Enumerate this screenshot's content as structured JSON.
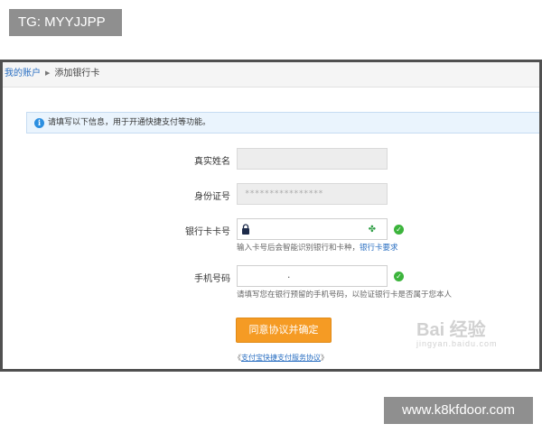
{
  "watermarks": {
    "top_left": "TG: MYYJJPP",
    "bottom_right": "www.k8kfdoor.com",
    "baidu_main": "Bai 经验",
    "baidu_sub": "jingyan.baidu.com"
  },
  "breadcrumb": {
    "root": "我的账户",
    "current": "添加银行卡"
  },
  "notice": {
    "icon": "info-icon",
    "text": "请填写以下信息，用于开通快捷支付等功能。"
  },
  "form": {
    "name": {
      "label": "真实姓名",
      "value": ""
    },
    "id_number": {
      "label": "身份证号",
      "value": "****************"
    },
    "card_number": {
      "label": "银行卡卡号",
      "value": "",
      "hint": "输入卡号后会智能识别银行和卡种，",
      "hint_link": "银行卡要求"
    },
    "phone": {
      "label": "手机号码",
      "value": ".",
      "hint": "请填写您在银行预留的手机号码，以验证银行卡是否属于您本人"
    }
  },
  "submit_label": "同意协议并确定",
  "agreement": {
    "open": "《",
    "link": "支付宝快捷支付服务协议",
    "close": "》"
  },
  "colors": {
    "accent_button": "#f59b24",
    "link": "#2a6fc2",
    "success": "#3cb43c",
    "info": "#2c8fe0"
  }
}
